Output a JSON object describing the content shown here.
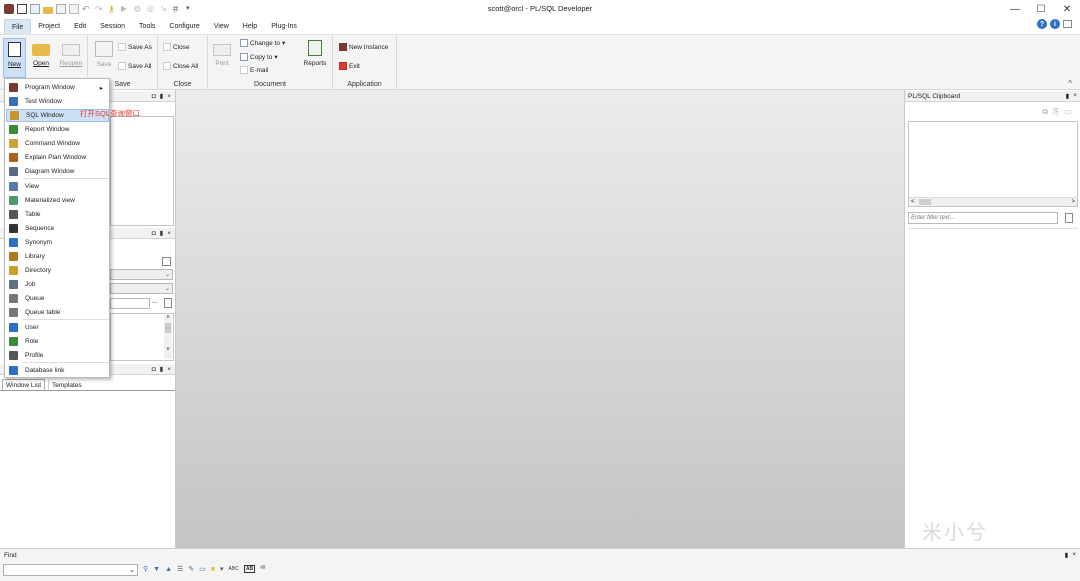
{
  "window": {
    "title": "scott@orcl - PL/SQL Developer",
    "min_label": "—",
    "max_label": "☐",
    "close_label": "✕"
  },
  "menubar": {
    "items": [
      "File",
      "Project",
      "Edit",
      "Session",
      "Tools",
      "Configure",
      "View",
      "Help",
      "Plug-Ins"
    ],
    "help_glyphs": [
      "?",
      "i"
    ]
  },
  "ribbon": {
    "file_group": {
      "new_label": "New",
      "open_label": "Open",
      "reopen_label": "Reopen"
    },
    "save_group": {
      "label": "Save",
      "save_label": "Save",
      "save_as_label": "Save As",
      "save_all_label": "Save All"
    },
    "close_group": {
      "label": "Close",
      "close_label": "Close",
      "close_all_label": "Close All"
    },
    "document_group": {
      "label": "Document",
      "print_label": "Print",
      "change_to_label": "Change to",
      "copy_to_label": "Copy to",
      "email_label": "E-mail",
      "reports_label": "Reports"
    },
    "application_group": {
      "label": "Application",
      "new_instance_label": "New Instance",
      "exit_label": "Exit"
    },
    "collapse_glyph": "^"
  },
  "new_menu": {
    "items": [
      {
        "label": "Program Window",
        "icon": "program-window-icon",
        "submenu": "▸"
      },
      {
        "label": "Test Window",
        "icon": "test-window-icon"
      },
      {
        "label": "SQL Window",
        "icon": "sql-window-icon"
      },
      {
        "label": "Report Window",
        "icon": "report-window-icon"
      },
      {
        "label": "Command Window",
        "icon": "command-window-icon"
      },
      {
        "label": "Explain Plan Window",
        "icon": "explain-plan-icon"
      },
      {
        "label": "Diagram Window",
        "icon": "diagram-window-icon"
      },
      {
        "label": "View",
        "icon": "view-icon"
      },
      {
        "label": "Materialized view",
        "icon": "materialized-view-icon"
      },
      {
        "label": "Table",
        "icon": "table-icon"
      },
      {
        "label": "Sequence",
        "icon": "sequence-icon"
      },
      {
        "label": "Synonym",
        "icon": "synonym-icon"
      },
      {
        "label": "Library",
        "icon": "library-icon"
      },
      {
        "label": "Directory",
        "icon": "directory-icon"
      },
      {
        "label": "Job",
        "icon": "job-icon"
      },
      {
        "label": "Queue",
        "icon": "queue-icon"
      },
      {
        "label": "Queue table",
        "icon": "queue-table-icon"
      },
      {
        "label": "User",
        "icon": "user-icon"
      },
      {
        "label": "Role",
        "icon": "role-icon"
      },
      {
        "label": "Profile",
        "icon": "profile-icon"
      },
      {
        "label": "Database link",
        "icon": "database-link-icon"
      }
    ],
    "selected_index": 2,
    "annotation": "打开SQL查询窗口"
  },
  "left_panel": {
    "tabs": [
      "Window List",
      "Templates"
    ],
    "ellipsis": "..."
  },
  "clipboard": {
    "title": "PL/SQL Clipboard",
    "filter_placeholder": "Enter filter text...",
    "scroll_left": "<",
    "scroll_right": ">"
  },
  "find": {
    "label": "Find",
    "tool_glyphs": [
      "ABC",
      "AB"
    ]
  },
  "watermark": "米小兮",
  "colors": {
    "accent": "#2d6fc4",
    "annotation": "#e8342a",
    "help_blue": "#2d6fc4"
  }
}
